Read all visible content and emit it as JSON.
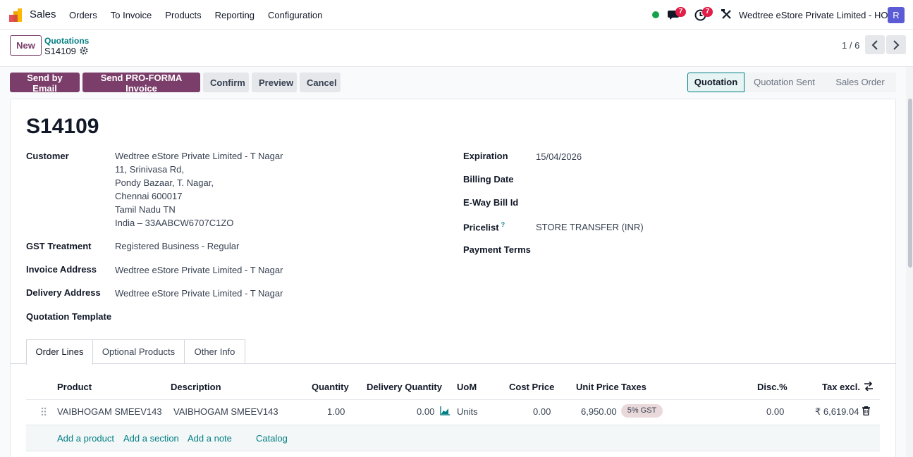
{
  "navbar": {
    "app_name": "Sales",
    "menu": [
      "Orders",
      "To Invoice",
      "Products",
      "Reporting",
      "Configuration"
    ],
    "chat_count": "7",
    "activity_count": "7",
    "company": "Wedtree eStore Private Limited - HO",
    "avatar_letter": "R"
  },
  "control": {
    "new_label": "New",
    "breadcrumb_parent": "Quotations",
    "breadcrumb_current": "S14109",
    "pager": "1 / 6"
  },
  "actions": {
    "send_email": "Send by Email",
    "send_proforma": "Send PRO-FORMA Invoice",
    "confirm": "Confirm",
    "preview": "Preview",
    "cancel": "Cancel"
  },
  "status": {
    "steps": [
      "Quotation",
      "Quotation Sent",
      "Sales Order"
    ],
    "active": "Quotation"
  },
  "record": {
    "name": "S14109",
    "left_fields": {
      "customer_label": "Customer",
      "customer_lines": [
        "Wedtree eStore Private Limited - T Nagar",
        "11, Srinivasa Rd,",
        "Pondy Bazaar, T. Nagar,",
        "Chennai 600017",
        "Tamil Nadu TN",
        "India – 33AABCW6707C1ZO"
      ],
      "gst_label": "GST Treatment",
      "gst_value": "Registered Business - Regular",
      "invoice_label": "Invoice Address",
      "invoice_value": "Wedtree eStore Private Limited - T Nagar",
      "delivery_label": "Delivery Address",
      "delivery_value": "Wedtree eStore Private Limited - T Nagar",
      "template_label": "Quotation Template"
    },
    "right_fields": {
      "expiration_label": "Expiration",
      "expiration_value": "15/04/2026",
      "billing_label": "Billing Date",
      "eway_label": "E-Way Bill Id",
      "pricelist_label": "Pricelist",
      "pricelist_help": "?",
      "pricelist_value": "STORE TRANSFER (INR)",
      "payment_label": "Payment Terms"
    }
  },
  "tabs": [
    "Order Lines",
    "Optional Products",
    "Other Info"
  ],
  "order_lines": {
    "columns": [
      "Product",
      "Description",
      "Quantity",
      "Delivery Quantity",
      "UoM",
      "Cost Price",
      "Unit Price",
      "Taxes",
      "Disc.%",
      "Tax excl."
    ],
    "rows": [
      {
        "product": "VAIBHOGAM SMEEV143",
        "description": "VAIBHOGAM SMEEV143",
        "quantity": "1.00",
        "delivery_quantity": "0.00",
        "uom": "Units",
        "cost_price": "0.00",
        "unit_price": "6,950.00",
        "taxes": "5% GST",
        "discount": "0.00",
        "tax_excl": "₹ 6,619.04"
      }
    ],
    "add_links": [
      "Add a product",
      "Add a section",
      "Add a note",
      "Catalog"
    ]
  },
  "colors": {
    "brand": "#7b3e6b",
    "accent": "#017e84",
    "badge": "#e11d48"
  }
}
